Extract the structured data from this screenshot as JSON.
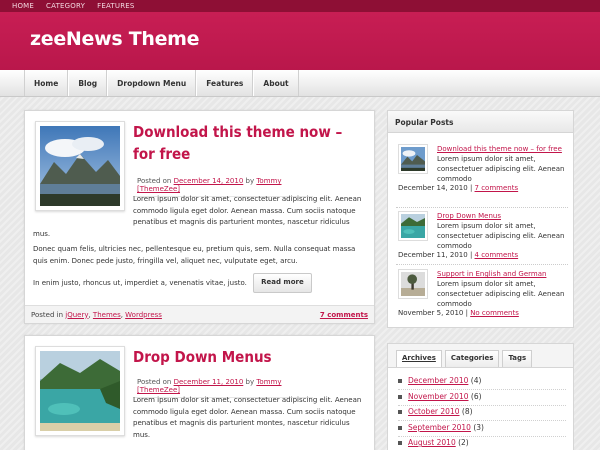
{
  "topbar": {
    "items": [
      "HOME",
      "CATEGORY",
      "FEATURES"
    ]
  },
  "header": {
    "title": "zeeNews Theme"
  },
  "nav": {
    "items": [
      "Home",
      "Blog",
      "Dropdown Menu",
      "Features",
      "About"
    ]
  },
  "posts": [
    {
      "title": "Download this theme now – for free",
      "meta_prefix": "Posted on",
      "date": "December 14, 2010",
      "meta_by": "by",
      "author": "Tommy [ThemeZee]",
      "excerpt": "Lorem ipsum dolor sit amet, consectetuer adipiscing elit. Aenean commodo ligula eget dolor. Aenean massa. Cum sociis natoque penatibus et magnis dis parturient montes, nascetur ridiculus",
      "excerpt_tail": "mus.",
      "para2": "Donec quam felis, ultricies nec, pellentesque eu, pretium quis, sem. Nulla consequat massa quis enim. Donec pede justo, fringilla vel, aliquet nec, vulputate eget, arcu.",
      "para3": "In enim justo, rhoncus ut, imperdiet a, venenatis vitae, justo.",
      "readmore": "Read more",
      "footer_prefix": "Posted in",
      "categories": [
        "jQuery",
        "Themes",
        "Wordpress"
      ],
      "comments": "7 comments"
    },
    {
      "title": "Drop Down Menus",
      "meta_prefix": "Posted on",
      "date": "December 11, 2010",
      "meta_by": "by",
      "author": "Tommy [ThemeZee]",
      "excerpt": "Lorem ipsum dolor sit amet, consectetuer adipiscing elit. Aenean commodo ligula eget dolor. Aenean massa. Cum sociis natoque penatibus et magnis dis parturient montes, nascetur ridiculus",
      "excerpt_tail": "mus."
    }
  ],
  "popular": {
    "heading": "Popular Posts",
    "items": [
      {
        "title": "Download this theme now – for free",
        "excerpt": "Lorem ipsum dolor sit amet, consectetuer adipiscing elit. Aenean commodo",
        "date": "December 14, 2010",
        "sep": "|",
        "comments": "7 comments"
      },
      {
        "title": "Drop Down Menus",
        "excerpt": "Lorem ipsum dolor sit amet, consectetuer adipiscing elit. Aenean commodo",
        "date": "December 11, 2010",
        "sep": "|",
        "comments": "4 comments"
      },
      {
        "title": "Support in English and German",
        "excerpt": "Lorem ipsum dolor sit amet, consectetuer adipiscing elit. Aenean commodo",
        "date": "November 5, 2010",
        "sep": "|",
        "comments": "No comments"
      }
    ]
  },
  "tabs": {
    "items": [
      "Archives",
      "Categories",
      "Tags"
    ],
    "archives": [
      {
        "month": "December 2010",
        "count": "(4)"
      },
      {
        "month": "November 2010",
        "count": "(6)"
      },
      {
        "month": "October 2010",
        "count": "(8)"
      },
      {
        "month": "September 2010",
        "count": "(3)"
      },
      {
        "month": "August 2010",
        "count": "(2)"
      }
    ]
  },
  "colors": {
    "brand": "#c2154a",
    "topbar": "#8e0f35",
    "header": "#c81e54"
  }
}
